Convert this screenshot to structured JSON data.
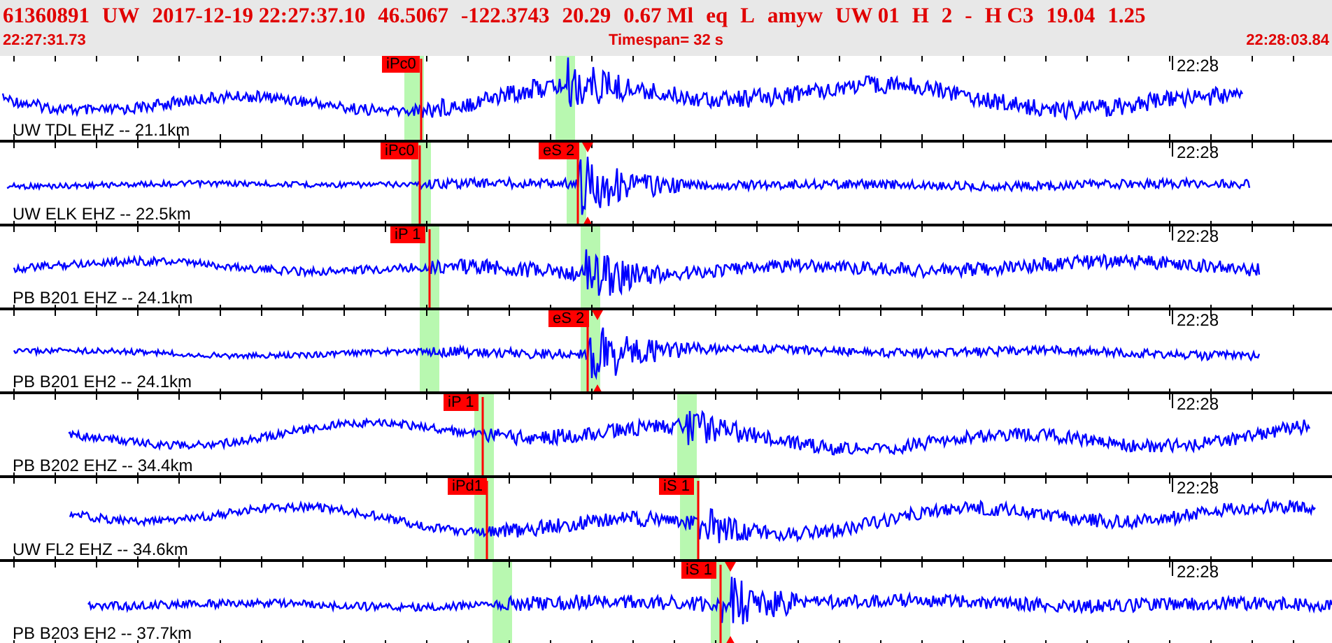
{
  "header": {
    "title_fields": [
      "61360891",
      "UW",
      "2017-12-19 22:27:37.10",
      "46.5067",
      "-122.3743",
      "20.29",
      "0.67 Ml",
      "eq",
      "L",
      "amyw",
      "UW 01",
      "H",
      "2",
      "-",
      "H C3",
      "19.04",
      "1.25"
    ],
    "start_time": "22:27:31.73",
    "timespan": "Timespan=  32 s",
    "end_time": "22:28:03.84"
  },
  "traces": [
    {
      "station": "UW TDL EHZ -- 21.1km",
      "minute_label": "22:28",
      "picks": [
        {
          "label": "iPc0",
          "marker": false
        }
      ]
    },
    {
      "station": "UW ELK EHZ -- 22.5km",
      "minute_label": "22:28",
      "picks": [
        {
          "label": "iPc0",
          "marker": false
        },
        {
          "label": "eS 2",
          "marker": true
        }
      ]
    },
    {
      "station": "PB B201 EHZ -- 24.1km",
      "minute_label": "22:28",
      "picks": [
        {
          "label": "iP 1",
          "marker": false
        }
      ]
    },
    {
      "station": "PB B201 EH2 -- 24.1km",
      "minute_label": "22:28",
      "picks": [
        {
          "label": "eS 2",
          "marker": true
        }
      ]
    },
    {
      "station": "PB B202 EHZ -- 34.4km",
      "minute_label": "22:28",
      "picks": [
        {
          "label": "iP 1",
          "marker": false
        }
      ]
    },
    {
      "station": "UW FL2 EHZ -- 34.6km",
      "minute_label": "22:28",
      "picks": [
        {
          "label": "iPd1",
          "marker": false
        },
        {
          "label": "iS 1",
          "marker": false
        }
      ]
    },
    {
      "station": "PB B203 EH2 -- 37.7km",
      "minute_label": "22:28",
      "picks": [
        {
          "label": "iS 1",
          "marker": true
        }
      ]
    }
  ]
}
